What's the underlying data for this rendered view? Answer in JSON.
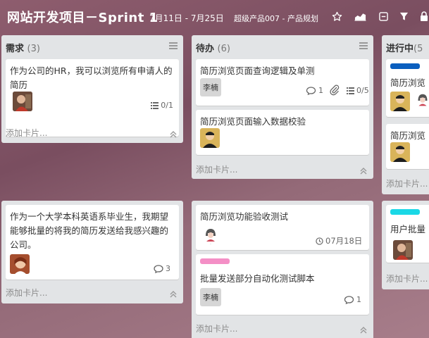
{
  "header": {
    "title": "网站开发项目－Sprint 1",
    "date_range": "7月11日 - 7月25日",
    "team": "超级产品007 - 产品规划"
  },
  "icons": [
    "star-icon",
    "chart-icon",
    "archive-icon",
    "filter-icon",
    "lock-icon"
  ],
  "lists": [
    {
      "name": "需求",
      "count": "(3)",
      "add_label": "添加卡片...",
      "cards": [
        {
          "title": "作为公司的HR，我可以浏览所有申请人的简历",
          "checklist": "0/1"
        }
      ]
    },
    {
      "name": "需求",
      "count": "",
      "add_label": "添加卡片...",
      "cards": [
        {
          "title": "作为一个大学本科英语系毕业生，我期望能够批量的将我的简历发送给我感兴趣的公司。",
          "comments": "3"
        }
      ]
    },
    {
      "name": "待办",
      "count": "(6)",
      "add_label": "添加卡片...",
      "cards": [
        {
          "title": "简历浏览页面查询逻辑及单测",
          "member": "李楠",
          "comments": "1",
          "checklist": "0/5"
        },
        {
          "title": "简历浏览页面输入数据校验"
        }
      ]
    },
    {
      "name": "待办",
      "count": "",
      "add_label": "添加卡片...",
      "cards": [
        {
          "title": "简历浏览功能验收测试",
          "due": "07月18日"
        },
        {
          "title": "批量发送部分自动化测试脚本",
          "member": "李楠",
          "comments": "1",
          "label_color": "#f48fc6"
        }
      ]
    },
    {
      "name": "进行中",
      "count": "(5",
      "add_label": "添加卡片...",
      "cards": [
        {
          "title": "简历浏览",
          "label_color": "#0a5fbf"
        },
        {
          "title": "简历浏览"
        }
      ]
    },
    {
      "name": "进行中",
      "count": "",
      "add_label": "添加卡片...",
      "cards": [
        {
          "title": "用户批量",
          "label_color": "#1ad8e6"
        }
      ]
    }
  ]
}
